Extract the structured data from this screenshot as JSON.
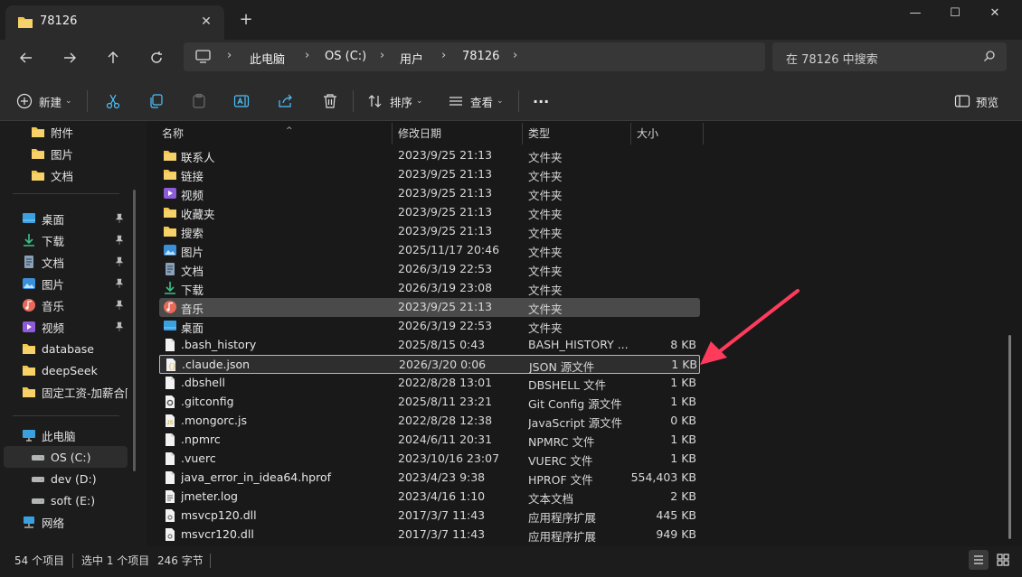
{
  "window": {
    "tab_title": "78126",
    "close_tab": "✕",
    "new_tab": "+",
    "minimize": "—",
    "maximize": "☐",
    "close": "✕"
  },
  "address": {
    "segments": [
      "此电脑",
      "OS (C:)",
      "用户",
      "78126"
    ],
    "search_placeholder": "在 78126 中搜索"
  },
  "toolbar": {
    "new_label": "新建",
    "sort_label": "排序",
    "view_label": "查看",
    "more_label": "···",
    "preview_label": "预览"
  },
  "sidebar": {
    "top_items": [
      {
        "label": "附件",
        "icon": "folder-icon"
      },
      {
        "label": "图片",
        "icon": "folder-icon"
      },
      {
        "label": "文档",
        "icon": "folder-icon"
      }
    ],
    "quick_items": [
      {
        "label": "桌面",
        "icon": "desktop-icon",
        "pinned": true
      },
      {
        "label": "下载",
        "icon": "download-icon",
        "pinned": true
      },
      {
        "label": "文档",
        "icon": "document-icon",
        "pinned": true
      },
      {
        "label": "图片",
        "icon": "pictures-icon",
        "pinned": true
      },
      {
        "label": "音乐",
        "icon": "music-icon",
        "pinned": true
      },
      {
        "label": "视频",
        "icon": "video-icon",
        "pinned": true
      },
      {
        "label": "database",
        "icon": "folder-icon",
        "pinned": false
      },
      {
        "label": "deepSeek",
        "icon": "folder-icon",
        "pinned": false
      },
      {
        "label": "固定工资-加薪合同",
        "icon": "folder-icon",
        "pinned": false
      }
    ],
    "drive_items": [
      {
        "label": "此电脑",
        "icon": "this-pc-icon"
      },
      {
        "label": "OS (C:)",
        "icon": "drive-icon",
        "selected": true
      },
      {
        "label": "dev (D:)",
        "icon": "drive-icon"
      },
      {
        "label": "soft (E:)",
        "icon": "drive-icon"
      },
      {
        "label": "网络",
        "icon": "network-icon"
      }
    ]
  },
  "columns": {
    "name": "名称",
    "date": "修改日期",
    "type": "类型",
    "size": "大小"
  },
  "files": [
    {
      "name": "联系人",
      "date": "2023/9/25 21:13",
      "type": "文件夹",
      "size": "",
      "icon": "folder-icon"
    },
    {
      "name": "链接",
      "date": "2023/9/25 21:13",
      "type": "文件夹",
      "size": "",
      "icon": "folder-icon"
    },
    {
      "name": "视频",
      "date": "2023/9/25 21:13",
      "type": "文件夹",
      "size": "",
      "icon": "video-icon"
    },
    {
      "name": "收藏夹",
      "date": "2023/9/25 21:13",
      "type": "文件夹",
      "size": "",
      "icon": "folder-icon"
    },
    {
      "name": "搜索",
      "date": "2023/9/25 21:13",
      "type": "文件夹",
      "size": "",
      "icon": "folder-icon"
    },
    {
      "name": "图片",
      "date": "2025/11/17 20:46",
      "type": "文件夹",
      "size": "",
      "icon": "pictures-icon"
    },
    {
      "name": "文档",
      "date": "2026/3/19 22:53",
      "type": "文件夹",
      "size": "",
      "icon": "document-icon"
    },
    {
      "name": "下载",
      "date": "2026/3/19 23:08",
      "type": "文件夹",
      "size": "",
      "icon": "download-icon"
    },
    {
      "name": "音乐",
      "date": "2023/9/25 21:13",
      "type": "文件夹",
      "size": "",
      "icon": "music-icon",
      "state": "hover"
    },
    {
      "name": "桌面",
      "date": "2026/3/19 22:53",
      "type": "文件夹",
      "size": "",
      "icon": "desktop-icon"
    },
    {
      "name": ".bash_history",
      "date": "2025/8/15 0:43",
      "type": "BASH_HISTORY ...",
      "size": "8 KB",
      "icon": "file-icon"
    },
    {
      "name": ".claude.json",
      "date": "2026/3/20 0:06",
      "type": "JSON 源文件",
      "size": "1 KB",
      "icon": "json-file-icon",
      "state": "selected"
    },
    {
      "name": ".dbshell",
      "date": "2022/8/28 13:01",
      "type": "DBSHELL 文件",
      "size": "1 KB",
      "icon": "file-icon"
    },
    {
      "name": ".gitconfig",
      "date": "2025/8/11 23:21",
      "type": "Git Config 源文件",
      "size": "1 KB",
      "icon": "config-file-icon"
    },
    {
      "name": ".mongorc.js",
      "date": "2022/8/28 12:38",
      "type": "JavaScript 源文件",
      "size": "0 KB",
      "icon": "js-file-icon"
    },
    {
      "name": ".npmrc",
      "date": "2024/6/11 20:31",
      "type": "NPMRC 文件",
      "size": "1 KB",
      "icon": "file-icon"
    },
    {
      "name": ".vuerc",
      "date": "2023/10/16 23:07",
      "type": "VUERC 文件",
      "size": "1 KB",
      "icon": "file-icon"
    },
    {
      "name": "java_error_in_idea64.hprof",
      "date": "2023/4/23 9:38",
      "type": "HPROF 文件",
      "size": "554,403 KB",
      "icon": "file-icon"
    },
    {
      "name": "jmeter.log",
      "date": "2023/4/16 1:10",
      "type": "文本文档",
      "size": "2 KB",
      "icon": "text-file-icon"
    },
    {
      "name": "msvcp120.dll",
      "date": "2017/3/7 11:43",
      "type": "应用程序扩展",
      "size": "445 KB",
      "icon": "dll-file-icon"
    },
    {
      "name": "msvcr120.dll",
      "date": "2017/3/7 11:43",
      "type": "应用程序扩展",
      "size": "949 KB",
      "icon": "dll-file-icon"
    }
  ],
  "status": {
    "count": "54 个项目",
    "selected": "选中 1 个项目",
    "size": "246 字节"
  },
  "colors": {
    "folder": "#f3c64a",
    "accent": "#4cc2ff",
    "annotation_arrow": "#ff3b5c"
  }
}
